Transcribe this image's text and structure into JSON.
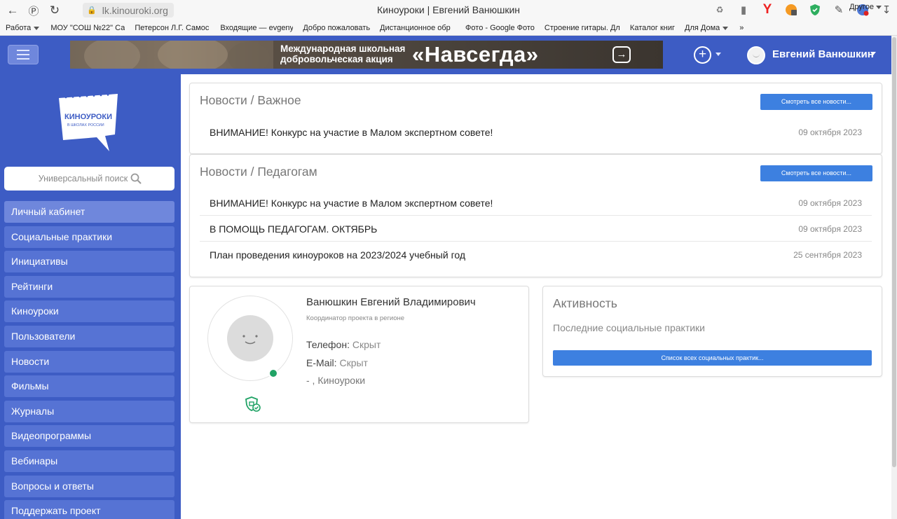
{
  "browser": {
    "url": "lk.kinouroki.org",
    "tab_title": "Киноуроки | Евгений Ванюшкин",
    "bookmarks": [
      "Работа",
      "МОУ \"СОШ №22\" Са",
      "Петерсон Л.Г. Самос",
      "Входящие — evgeny",
      "Добро пожаловать",
      "Дистанционное обр",
      "Фото - Google Фото",
      "Строение гитары. Дл",
      "Каталог книг",
      "Для Дома"
    ],
    "bookmarks_more": "»",
    "bookmarks_other": "Другое"
  },
  "header": {
    "banner_sub": "Международная школьная добровольческая акция",
    "banner_main": "«Навсегда»",
    "user_name": "Евгений Ванюшкин"
  },
  "sidebar": {
    "search_placeholder": "Универсальный поиск",
    "logo_text": "КИНОУРОКИ",
    "logo_sub": "В ШКОЛАХ РОССИИ",
    "items": [
      {
        "label": "Личный кабинет"
      },
      {
        "label": "Социальные практики"
      },
      {
        "label": "Инициативы"
      },
      {
        "label": "Рейтинги"
      },
      {
        "label": "Киноуроки"
      },
      {
        "label": "Пользователи"
      },
      {
        "label": "Новости"
      },
      {
        "label": "Фильмы"
      },
      {
        "label": "Журналы"
      },
      {
        "label": "Видеопрограммы"
      },
      {
        "label": "Вебинары"
      },
      {
        "label": "Вопросы и ответы"
      },
      {
        "label": "Поддержать проект"
      }
    ]
  },
  "news_important": {
    "title": "Новости / Важное",
    "button": "Смотреть все новости...",
    "items": [
      {
        "title": "ВНИМАНИЕ! Конкурс на участие в Малом экспертном совете!",
        "date": "09 октября 2023"
      }
    ]
  },
  "news_teachers": {
    "title": "Новости / Педагогам",
    "button": "Смотреть все новости...",
    "items": [
      {
        "title": "ВНИМАНИЕ! Конкурс на участие в Малом экспертном совете!",
        "date": "09 октября 2023"
      },
      {
        "title": "В ПОМОЩЬ ПЕДАГОГАМ. ОКТЯБРЬ",
        "date": "09 октября 2023"
      },
      {
        "title": "План проведения киноуроков на 2023/2024 учебный год",
        "date": "25 сентября 2023"
      }
    ]
  },
  "profile": {
    "name": "Ванюшкин Евгений Владимирович",
    "role": "Координатор проекта в регионе",
    "phone_label": "Телефон:",
    "phone_value": "Скрыт",
    "email_label": "E-Mail:",
    "email_value": "Скрыт",
    "location": "- , Киноуроки"
  },
  "activity": {
    "title": "Активность",
    "subtitle": "Последние социальные практики",
    "button": "Список всех социальных практик..."
  },
  "colors": {
    "primary": "#3d5cc4",
    "menu_item": "#5673d4",
    "button": "#3d80e0",
    "online": "#21a366"
  }
}
